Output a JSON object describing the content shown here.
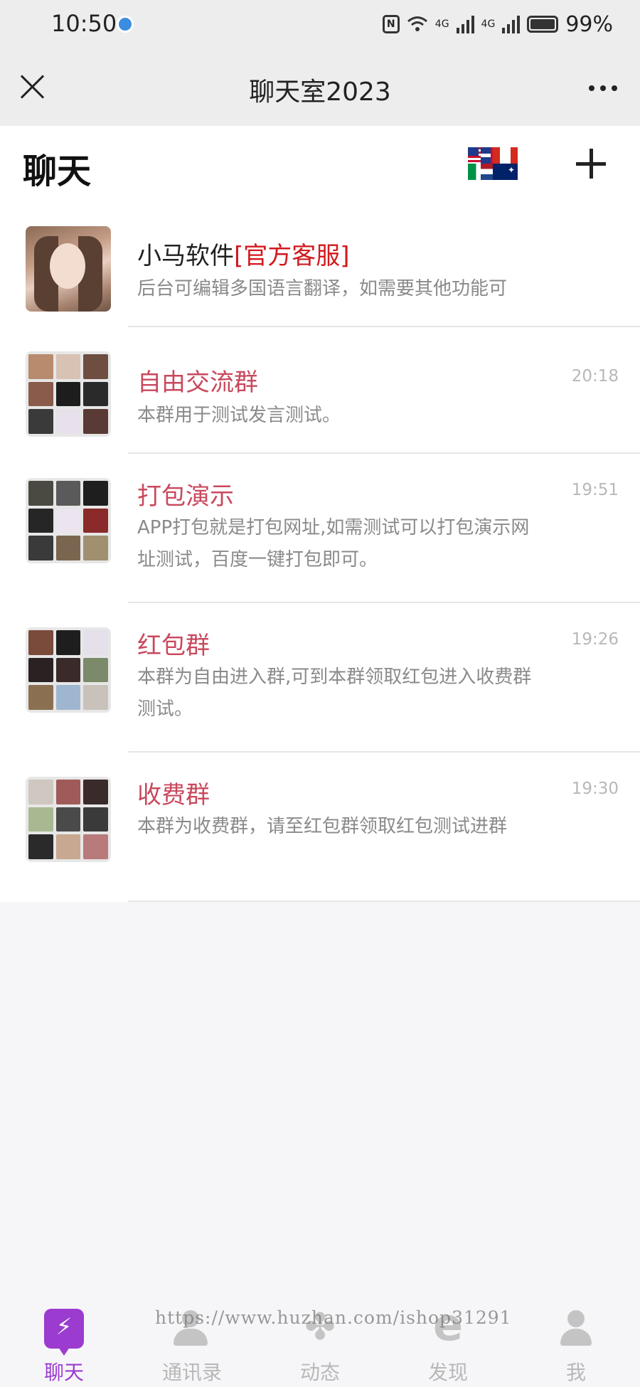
{
  "status_bar": {
    "time": "10:50",
    "net_1": "4G",
    "net_2": "4G",
    "battery": "99%"
  },
  "nav": {
    "title": "聊天室2023"
  },
  "header": {
    "title": "聊天"
  },
  "chats": [
    {
      "name": "小马软件",
      "tag": "[官方客服]",
      "preview": "后台可编辑多国语言翻译，如需要其他功能可",
      "time": "",
      "name_color": "#222222"
    },
    {
      "name": "自由交流群",
      "tag": "",
      "preview": "本群用于测试发言测试。",
      "time": "20:18",
      "name_color": "#c9485d"
    },
    {
      "name": "打包演示",
      "tag": "",
      "preview": "APP打包就是打包网址,如需测试可以打包演示网址测试，百度一键打包即可。",
      "time": "19:51",
      "name_color": "#c9485d"
    },
    {
      "name": "红包群",
      "tag": "",
      "preview": "本群为自由进入群,可到本群领取红包进入收费群测试。",
      "time": "19:26",
      "name_color": "#c9485d"
    },
    {
      "name": "收费群",
      "tag": "",
      "preview": "本群为收费群，请至红包群领取红包测试进群",
      "time": "19:30",
      "name_color": "#c9485d"
    }
  ],
  "tabs": [
    {
      "label": "聊天",
      "icon": "chat-icon",
      "active": true
    },
    {
      "label": "通讯录",
      "icon": "contacts-icon",
      "active": false
    },
    {
      "label": "动态",
      "icon": "moments-icon",
      "active": false
    },
    {
      "label": "发现",
      "icon": "discover-icon",
      "active": false
    },
    {
      "label": "我",
      "icon": "me-icon",
      "active": false
    }
  ],
  "watermark": "https://www.huzhan.com/ishop31291",
  "colors": {
    "accent": "#9b3bcf",
    "group_name": "#c9485d",
    "official_tag": "#d2191c"
  }
}
